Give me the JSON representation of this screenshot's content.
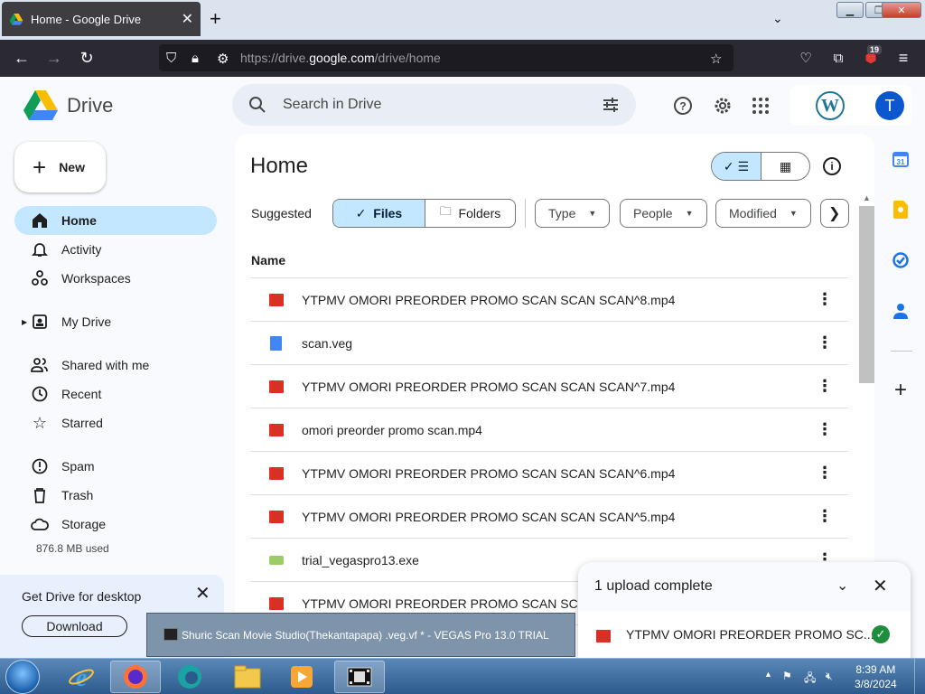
{
  "browser": {
    "tab_title": "Home - Google Drive",
    "url_prefix": "https://drive.",
    "url_host": "google.com",
    "url_path": "/drive/home",
    "extension_badge": "19"
  },
  "drive": {
    "logo_text": "Drive",
    "search_placeholder": "Search in Drive",
    "account_initial": "T",
    "wordpress_letter": "W",
    "new_label": "New",
    "nav": [
      {
        "label": "Home",
        "icon": "home-icon",
        "active": true
      },
      {
        "label": "Activity",
        "icon": "bell-icon"
      },
      {
        "label": "Workspaces",
        "icon": "workspaces-icon"
      },
      {
        "label": "My Drive",
        "icon": "my-drive-icon"
      },
      {
        "label": "Shared with me",
        "icon": "people-icon"
      },
      {
        "label": "Recent",
        "icon": "clock-icon"
      },
      {
        "label": "Starred",
        "icon": "star-icon"
      },
      {
        "label": "Spam",
        "icon": "spam-icon"
      },
      {
        "label": "Trash",
        "icon": "trash-icon"
      },
      {
        "label": "Storage",
        "icon": "cloud-icon"
      }
    ],
    "storage_used": "876.8 MB used",
    "promo": {
      "title": "Get Drive for desktop",
      "download_label": "Download"
    },
    "page_title": "Home",
    "suggested_label": "Suggested",
    "segment": {
      "files": "Files",
      "folders": "Folders"
    },
    "filters": [
      "Type",
      "People",
      "Modified"
    ],
    "column_name": "Name",
    "files": [
      {
        "name": "YTPMV OMORI PREORDER PROMO SCAN SCAN SCAN^8.mp4",
        "type": "video"
      },
      {
        "name": "scan.veg",
        "type": "doc"
      },
      {
        "name": "YTPMV OMORI PREORDER PROMO SCAN SCAN SCAN^7.mp4",
        "type": "video"
      },
      {
        "name": "omori preorder promo scan.mp4",
        "type": "video"
      },
      {
        "name": "YTPMV OMORI PREORDER PROMO SCAN SCAN SCAN^6.mp4",
        "type": "video"
      },
      {
        "name": "YTPMV OMORI PREORDER PROMO SCAN SCAN SCAN^5.mp4",
        "type": "video"
      },
      {
        "name": "trial_vegaspro13.exe",
        "type": "exe"
      },
      {
        "name": "YTPMV OMORI PREORDER PROMO SCAN SCAN",
        "type": "video"
      }
    ],
    "upload": {
      "title": "1 upload complete",
      "file_name": "YTPMV OMORI PREORDER PROMO SC..."
    }
  },
  "taskbar": {
    "preview_title": "Shuric Scan Movie Studio(Thekantapapa) .veg.vf * - VEGAS Pro 13.0 TRIAL",
    "time": "8:39 AM",
    "date": "3/8/2024"
  },
  "colors": {
    "accent": "#0b57d0",
    "active_nav": "#c2e7ff",
    "video_icon": "#d93025",
    "doc_icon": "#4285f4"
  }
}
